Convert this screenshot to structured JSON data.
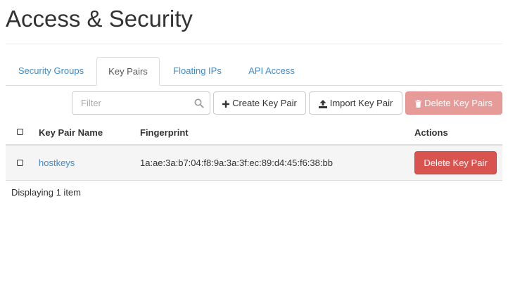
{
  "page": {
    "title": "Access & Security"
  },
  "tabs": [
    {
      "label": "Security Groups",
      "active": false
    },
    {
      "label": "Key Pairs",
      "active": true
    },
    {
      "label": "Floating IPs",
      "active": false
    },
    {
      "label": "API Access",
      "active": false
    }
  ],
  "toolbar": {
    "filter_placeholder": "Filter",
    "filter_value": "",
    "create_label": "Create Key Pair",
    "import_label": "Import Key Pair",
    "delete_all_label": "Delete Key Pairs"
  },
  "table": {
    "columns": [
      "Key Pair Name",
      "Fingerprint",
      "Actions"
    ],
    "rows": [
      {
        "name": "hostkeys",
        "fingerprint": "1a:ae:3a:b7:04:f8:9a:3a:3f:ec:89:d4:45:f6:38:bb",
        "action_label": "Delete Key Pair"
      }
    ],
    "footer": "Displaying 1 item"
  },
  "colors": {
    "link": "#428bca",
    "danger": "#d9534f",
    "danger_disabled": "#e69b99"
  }
}
